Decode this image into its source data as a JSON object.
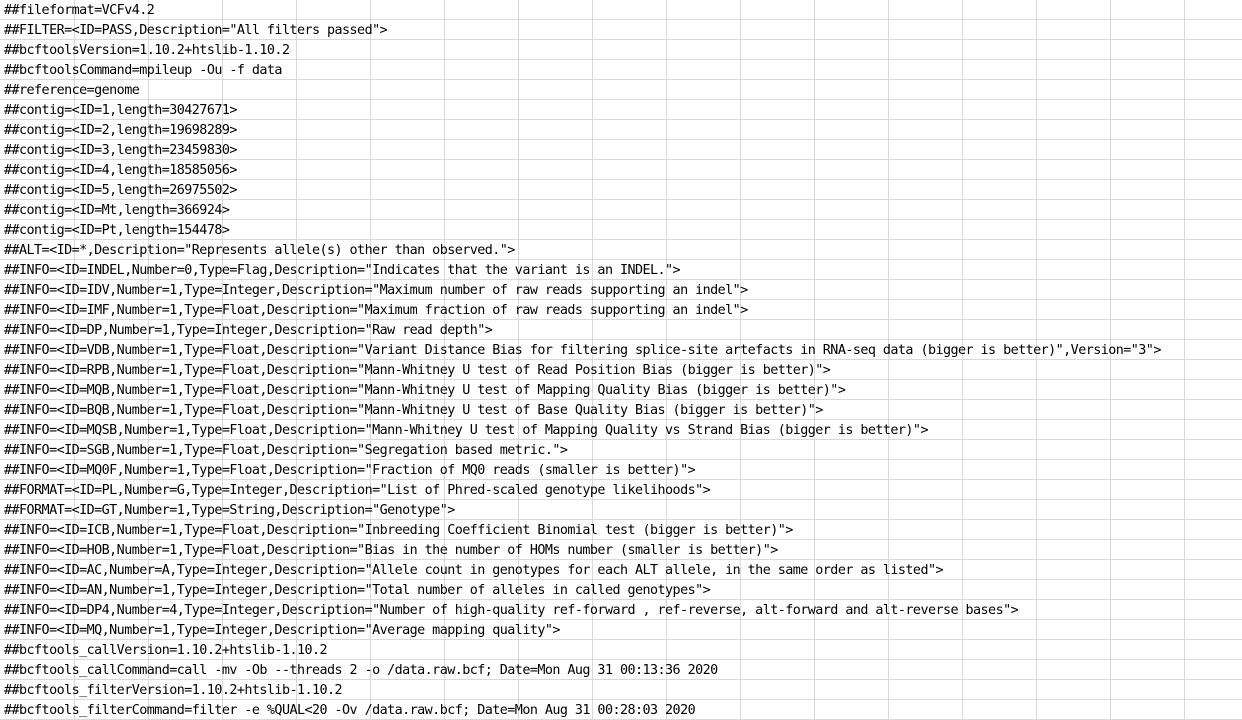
{
  "rows": [
    "##fileformat=VCFv4.2",
    "##FILTER=<ID=PASS,Description=\"All filters passed\">",
    "##bcftoolsVersion=1.10.2+htslib-1.10.2",
    "##bcftoolsCommand=mpileup -Ou -f data",
    "##reference=genome",
    "##contig=<ID=1,length=30427671>",
    "##contig=<ID=2,length=19698289>",
    "##contig=<ID=3,length=23459830>",
    "##contig=<ID=4,length=18585056>",
    "##contig=<ID=5,length=26975502>",
    "##contig=<ID=Mt,length=366924>",
    "##contig=<ID=Pt,length=154478>",
    "##ALT=<ID=*,Description=\"Represents allele(s) other than observed.\">",
    "##INFO=<ID=INDEL,Number=0,Type=Flag,Description=\"Indicates that the variant is an INDEL.\">",
    "##INFO=<ID=IDV,Number=1,Type=Integer,Description=\"Maximum number of raw reads supporting an indel\">",
    "##INFO=<ID=IMF,Number=1,Type=Float,Description=\"Maximum fraction of raw reads supporting an indel\">",
    "##INFO=<ID=DP,Number=1,Type=Integer,Description=\"Raw read depth\">",
    "##INFO=<ID=VDB,Number=1,Type=Float,Description=\"Variant Distance Bias for filtering splice-site artefacts in RNA-seq data (bigger is better)\",Version=\"3\">",
    "##INFO=<ID=RPB,Number=1,Type=Float,Description=\"Mann-Whitney U test of Read Position Bias (bigger is better)\">",
    "##INFO=<ID=MQB,Number=1,Type=Float,Description=\"Mann-Whitney U test of Mapping Quality Bias (bigger is better)\">",
    "##INFO=<ID=BQB,Number=1,Type=Float,Description=\"Mann-Whitney U test of Base Quality Bias (bigger is better)\">",
    "##INFO=<ID=MQSB,Number=1,Type=Float,Description=\"Mann-Whitney U test of Mapping Quality vs Strand Bias (bigger is better)\">",
    "##INFO=<ID=SGB,Number=1,Type=Float,Description=\"Segregation based metric.\">",
    "##INFO=<ID=MQ0F,Number=1,Type=Float,Description=\"Fraction of MQ0 reads (smaller is better)\">",
    "##FORMAT=<ID=PL,Number=G,Type=Integer,Description=\"List of Phred-scaled genotype likelihoods\">",
    "##FORMAT=<ID=GT,Number=1,Type=String,Description=\"Genotype\">",
    "##INFO=<ID=ICB,Number=1,Type=Float,Description=\"Inbreeding Coefficient Binomial test (bigger is better)\">",
    "##INFO=<ID=HOB,Number=1,Type=Float,Description=\"Bias in the number of HOMs number (smaller is better)\">",
    "##INFO=<ID=AC,Number=A,Type=Integer,Description=\"Allele count in genotypes for each ALT allele, in the same order as listed\">",
    "##INFO=<ID=AN,Number=1,Type=Integer,Description=\"Total number of alleles in called genotypes\">",
    "##INFO=<ID=DP4,Number=4,Type=Integer,Description=\"Number of high-quality ref-forward , ref-reverse, alt-forward and alt-reverse bases\">",
    "##INFO=<ID=MQ,Number=1,Type=Integer,Description=\"Average mapping quality\">",
    "##bcftools_callVersion=1.10.2+htslib-1.10.2",
    "##bcftools_callCommand=call -mv -Ob --threads 2 -o /data.raw.bcf; Date=Mon Aug 31 00:13:36 2020",
    "##bcftools_filterVersion=1.10.2+htslib-1.10.2",
    "##bcftools_filterCommand=filter -e %QUAL<20 -Ov /data.raw.bcf; Date=Mon Aug 31 00:28:03 2020"
  ]
}
